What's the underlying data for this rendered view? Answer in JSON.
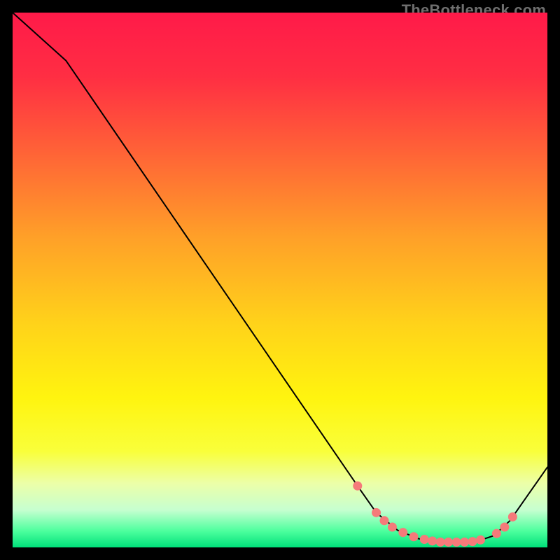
{
  "watermark": "TheBottleneck.com",
  "chart_data": {
    "type": "line",
    "title": "",
    "xlabel": "",
    "ylabel": "",
    "xlim": [
      0,
      100
    ],
    "ylim": [
      0,
      100
    ],
    "grid": false,
    "legend": false,
    "background_gradient": {
      "stops": [
        {
          "offset": 0.0,
          "color": "#ff1a49"
        },
        {
          "offset": 0.12,
          "color": "#ff2e43"
        },
        {
          "offset": 0.28,
          "color": "#ff6a35"
        },
        {
          "offset": 0.42,
          "color": "#ffa028"
        },
        {
          "offset": 0.58,
          "color": "#ffd21a"
        },
        {
          "offset": 0.72,
          "color": "#fff40f"
        },
        {
          "offset": 0.82,
          "color": "#f9ff3a"
        },
        {
          "offset": 0.88,
          "color": "#ecffa8"
        },
        {
          "offset": 0.93,
          "color": "#c6ffd0"
        },
        {
          "offset": 0.97,
          "color": "#4bff9d"
        },
        {
          "offset": 1.0,
          "color": "#00e07a"
        }
      ]
    },
    "series": [
      {
        "name": "bottleneck-curve",
        "color": "#000000",
        "stroke_width": 2,
        "x": [
          0.0,
          10.0,
          64.5,
          68.0,
          72.0,
          76.0,
          80.0,
          84.0,
          87.0,
          90.0,
          93.0,
          100.0
        ],
        "y": [
          100.0,
          91.0,
          11.5,
          6.5,
          3.2,
          1.6,
          1.0,
          1.0,
          1.2,
          2.2,
          5.0,
          15.0
        ]
      }
    ],
    "markers": {
      "name": "highlight-points",
      "color": "#f57a7a",
      "radius": 6.5,
      "x": [
        64.5,
        68.0,
        69.5,
        71.0,
        73.0,
        75.0,
        77.0,
        78.5,
        80.0,
        81.5,
        83.0,
        84.5,
        86.0,
        87.5,
        90.5,
        92.0,
        93.5
      ],
      "y": [
        11.5,
        6.5,
        5.0,
        3.8,
        2.8,
        2.0,
        1.5,
        1.2,
        1.0,
        1.0,
        1.0,
        1.0,
        1.1,
        1.4,
        2.6,
        3.8,
        5.7
      ]
    }
  }
}
